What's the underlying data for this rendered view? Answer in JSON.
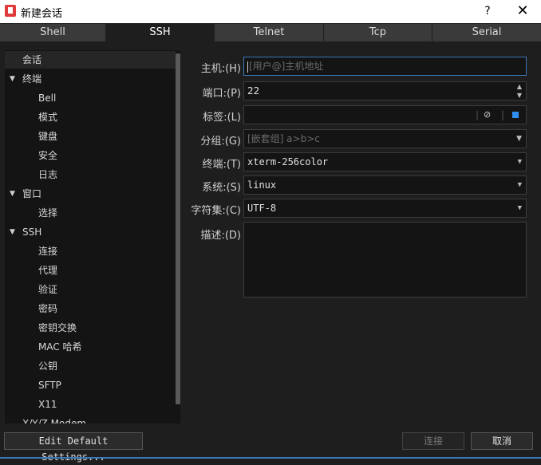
{
  "window": {
    "title": "新建会话",
    "help": "?",
    "close": "✕"
  },
  "tabs": [
    {
      "label": "Shell"
    },
    {
      "label": "SSH"
    },
    {
      "label": "Telnet"
    },
    {
      "label": "Tcp"
    },
    {
      "label": "Serial"
    }
  ],
  "tree": [
    {
      "label": "会话",
      "arrow": ""
    },
    {
      "label": "终端",
      "arrow": "▼"
    },
    {
      "label": "Bell",
      "arrow": ""
    },
    {
      "label": "模式",
      "arrow": ""
    },
    {
      "label": "键盘",
      "arrow": ""
    },
    {
      "label": "安全",
      "arrow": ""
    },
    {
      "label": "日志",
      "arrow": ""
    },
    {
      "label": "窗口",
      "arrow": "▼"
    },
    {
      "label": "选择",
      "arrow": ""
    },
    {
      "label": "SSH",
      "arrow": "▼"
    },
    {
      "label": "连接",
      "arrow": ""
    },
    {
      "label": "代理",
      "arrow": ""
    },
    {
      "label": "验证",
      "arrow": ""
    },
    {
      "label": "密码",
      "arrow": ""
    },
    {
      "label": "密钥交换",
      "arrow": ""
    },
    {
      "label": "MAC 哈希",
      "arrow": ""
    },
    {
      "label": "公钥",
      "arrow": ""
    },
    {
      "label": "SFTP",
      "arrow": ""
    },
    {
      "label": "X11",
      "arrow": ""
    },
    {
      "label": "X/Y/Z Modem",
      "arrow": ""
    }
  ],
  "form": {
    "host_label": "主机:(H)",
    "host_placeholder": "[用户@]主机地址",
    "port_label": "端口:(P)",
    "port_value": "22",
    "tag_label": "标签:(L)",
    "group_label": "分组:(G)",
    "group_placeholder": "[嵌套组] a>b>c",
    "term_label": "终端:(T)",
    "term_value": "xterm-256color",
    "system_label": "系统:(S)",
    "system_value": "linux",
    "charset_label": "字符集:(C)",
    "charset_value": "UTF-8",
    "desc_label": "描述:(D)"
  },
  "buttons": {
    "edit_defaults": "Edit Default Settings...",
    "connect": "连接",
    "cancel": "取消"
  },
  "colors": {
    "accent": "#3a78b8",
    "tag_color": "#2f8ff0"
  }
}
